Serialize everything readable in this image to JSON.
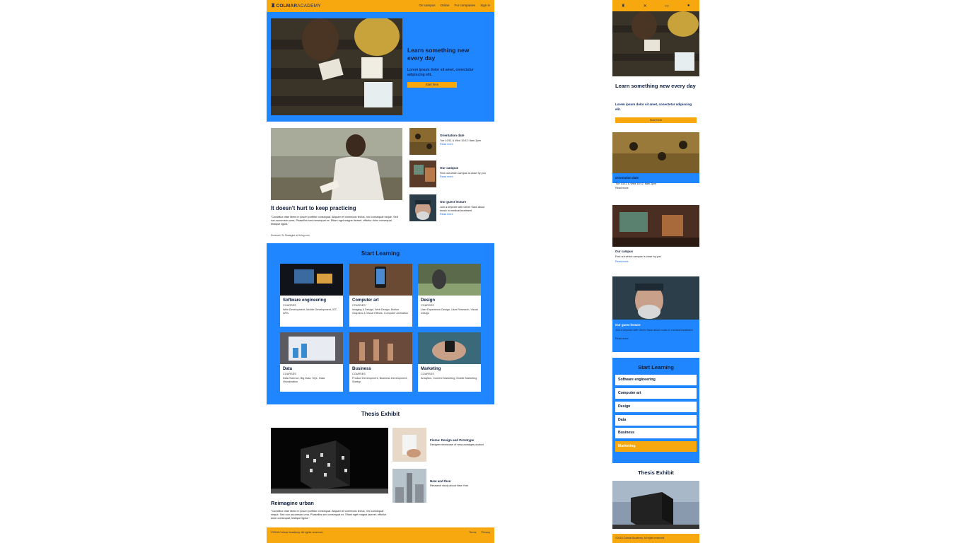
{
  "brand": {
    "name_bold": "COLMAR",
    "name_light": "ACADEMY"
  },
  "nav": {
    "links": [
      "On campus",
      "Online",
      "For companies",
      "Sign in"
    ]
  },
  "hero": {
    "title": "Learn something new every day",
    "subtitle": "Lorem ipsum dolor sit amet, conectetur adipiscing elit.",
    "button": "Start here"
  },
  "feature": {
    "title": "It doesn't hurt to keep practicing",
    "body": "\"Curabitur vitae libero in ipsum porttitor consequat. Aliquam et commodo lectus, nec consequat neque. Sed non accumsan urna. Phasellus sed consequat ex. Etiam eget magna laoreet, efficitur dolor consequat, tristique ligula.\"",
    "caption": "Emanuel, Sr Strategist at Hiring.com"
  },
  "events": [
    {
      "title": "Orientation date",
      "text": "Tue 10/11 & Wed 10/12: 8am-3pm",
      "more": "Read more"
    },
    {
      "title": "Our campus",
      "text": "Find out which campus is close by you",
      "more": "Read more"
    },
    {
      "title": "Our guest lecture",
      "text": "Join a keynote with Oliver Sack about music in medical treatment",
      "more": "Read more"
    }
  ],
  "learning": {
    "title": "Start Learning",
    "courses": [
      {
        "title": "Software engineering",
        "kind": "COURSES",
        "tags": "Web Development, Mobile Development, iOT, APIs"
      },
      {
        "title": "Computer art",
        "kind": "COURSES",
        "tags": "Imaging & Design, Web Design, Motion Graphics & Visual Effects, Computer Animation"
      },
      {
        "title": "Design",
        "kind": "COURSES",
        "tags": "User Experience Design, User Research, Visual Design"
      },
      {
        "title": "Data",
        "kind": "COURSES",
        "tags": "Data Science, Big Data, SQL, Data Visualization"
      },
      {
        "title": "Business",
        "kind": "COURSES",
        "tags": "Product Development, Business Development, Startup"
      },
      {
        "title": "Marketing",
        "kind": "COURSES",
        "tags": "Analytics, Content Marketing, Mobile Marketing"
      }
    ]
  },
  "thesis": {
    "title": "Thesis Exhibit",
    "main_title": "Reimagine urban",
    "main_body": "\"Curabitur vitae libero in ipsum porttitor consequat. Aliquam et commodo lectus, nec consequat neque. Sed non accumsan urna. Phasellus sed consequat ex. Etiam eget magna laoreet, efficitur dolor consequat, tristique ligula.\"",
    "items": [
      {
        "title": "Fisma: Design and Prototype",
        "text": "Designer showcase of new prototype product"
      },
      {
        "title": "Now and then",
        "text": "Research study about New York"
      }
    ]
  },
  "footer": {
    "copyright": "©2018 Colmar Academy. All rights reserved.",
    "links": [
      "Terms",
      "Privacy"
    ]
  },
  "mobile": {
    "nav_icons": [
      "crest-icon",
      "tools-icon",
      "monitor-icon",
      "user-icon"
    ],
    "active_course": "Marketing"
  },
  "colors": {
    "accent": "#f7a80f",
    "primary": "#1f86ff",
    "ink": "#0f1d3a"
  }
}
